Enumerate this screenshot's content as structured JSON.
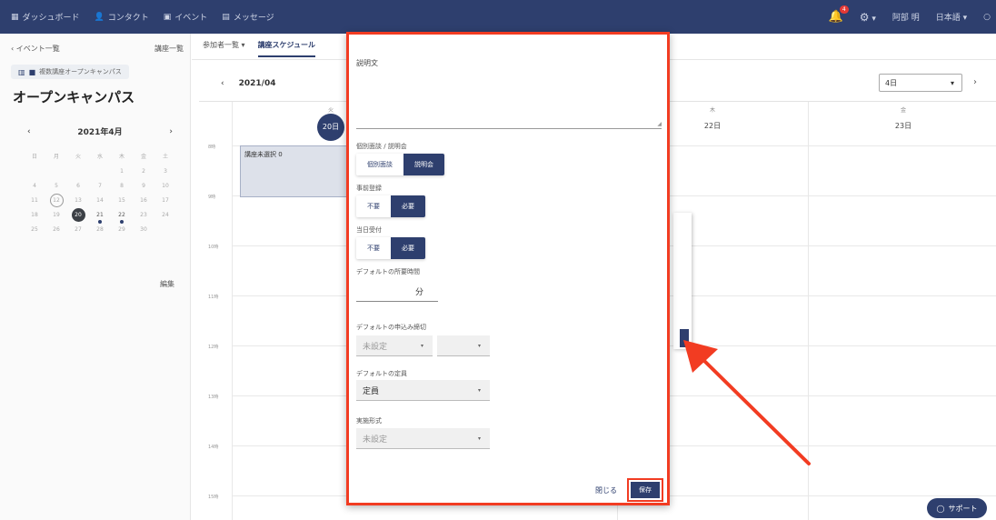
{
  "topnav": {
    "items": [
      {
        "icon": "dashboard-icon",
        "glyph": "▦",
        "label": "ダッシュボード"
      },
      {
        "icon": "contact-icon",
        "glyph": "👤",
        "label": "コンタクト"
      },
      {
        "icon": "event-icon",
        "glyph": "▣",
        "label": "イベント"
      },
      {
        "icon": "message-icon",
        "glyph": "▤",
        "label": "メッセージ"
      }
    ],
    "notification_count": "4",
    "user_name": "阿部 明",
    "language": "日本語 ▾",
    "settings_caret": "▾"
  },
  "sidebar": {
    "back_link": "‹ イベント一覧",
    "course_list_link": "講座一覧",
    "chip_label": "複数講座オープンキャンパス",
    "event_title": "オープンキャンパス",
    "calendar": {
      "prev": "‹",
      "next": "›",
      "month": "2021年4月",
      "weekdays": [
        "日",
        "月",
        "火",
        "水",
        "木",
        "金",
        "土"
      ],
      "weeks": [
        [
          "",
          "",
          "",
          "",
          "1",
          "2",
          "3"
        ],
        [
          "4",
          "5",
          "6",
          "7",
          "8",
          "9",
          "10"
        ],
        [
          "11",
          "12",
          "13",
          "14",
          "15",
          "16",
          "17"
        ],
        [
          "18",
          "19",
          "20",
          "21",
          "22",
          "23",
          "24"
        ],
        [
          "25",
          "26",
          "27",
          "28",
          "29",
          "30",
          ""
        ]
      ]
    },
    "edit_link": "編集"
  },
  "main": {
    "tabs": [
      {
        "label": "参加者一覧 ▾",
        "active": false
      },
      {
        "label": "講座スケジュール",
        "active": true
      }
    ],
    "week_label": "2021/04",
    "week_prev": "‹",
    "week_next": "›",
    "range_select": "4日",
    "range_caret": "▾",
    "days": [
      {
        "dow": "火",
        "date": "20日"
      },
      {
        "dow": "木",
        "date": "22日"
      },
      {
        "dow": "金",
        "date": "23日"
      }
    ],
    "time_labels": [
      "8時",
      "9時",
      "10時",
      "11時",
      "12時",
      "13時",
      "14時",
      "15時"
    ],
    "event_block_label": "講座未選択 0"
  },
  "modal": {
    "description_label": "説明文",
    "resize_grip": "◢",
    "interview_label": "個別面談 / 説明会",
    "interview_options": [
      "個別面談",
      "説明会"
    ],
    "preregistration_label": "事前登録",
    "preregistration_options": [
      "不要",
      "必要"
    ],
    "sameday_label": "当日受付",
    "sameday_options": [
      "不要",
      "必要"
    ],
    "default_duration_label": "デフォルトの所要時間",
    "minutes_unit": "分",
    "default_deadline_label": "デフォルトの申込み締切",
    "deadline_value": "未設定",
    "deadline_caret": "▾",
    "default_capacity_label": "デフォルトの定員",
    "capacity_value": "定員",
    "format_label": "実施形式",
    "format_value": "未設定",
    "close_label": "閉じる",
    "save_label": "保存"
  },
  "support_label": "サポート",
  "support_icon": "chat-bubble-icon",
  "colors": {
    "nav_bg": "#2e3f6e",
    "accent": "#2e3f6e",
    "highlight": "#f23c22"
  }
}
